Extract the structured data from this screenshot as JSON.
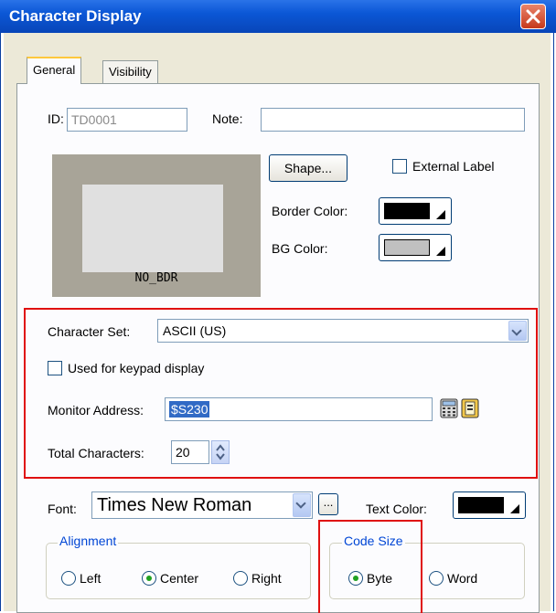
{
  "window": {
    "title": "Character Display"
  },
  "tabs": [
    {
      "label": "General",
      "active": true
    },
    {
      "label": "Visibility",
      "active": false
    }
  ],
  "general": {
    "id_label": "ID:",
    "id_value": "TD0001",
    "note_label": "Note:",
    "note_value": "",
    "preview_label": "NO_BDR",
    "shape_button": "Shape...",
    "external_label": {
      "label": "External Label",
      "checked": false
    },
    "border_color_label": "Border Color:",
    "border_color": "#000000",
    "bg_color_label": "BG Color:",
    "bg_color": "#c0c0c0"
  },
  "highlight_section": {
    "character_set_label": "Character Set:",
    "character_set_value": "ASCII (US)",
    "keypad_checkbox": {
      "label": "Used for keypad display",
      "checked": false
    },
    "monitor_address_label": "Monitor Address:",
    "monitor_address_value": "$S230",
    "total_characters_label": "Total Characters:",
    "total_characters_value": "20"
  },
  "font_row": {
    "font_label": "Font:",
    "font_value": "Times New Roman",
    "browse_button": "...",
    "text_color_label": "Text Color:",
    "text_color": "#000000"
  },
  "alignment": {
    "legend": "Alignment",
    "options": [
      "Left",
      "Center",
      "Right"
    ],
    "selected": "Center"
  },
  "code_size": {
    "legend": "Code Size",
    "options": [
      "Byte",
      "Word"
    ],
    "selected": "Byte"
  },
  "colors": {
    "title_bar": "#0b57d6",
    "highlight_border": "#e01010",
    "group_legend": "#0046d5",
    "dialog_bg": "#ece9d8"
  }
}
